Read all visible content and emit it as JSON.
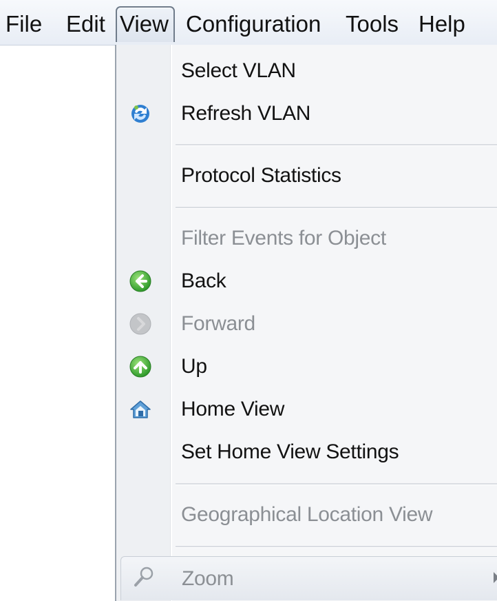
{
  "menubar": {
    "items": [
      {
        "label": "File"
      },
      {
        "label": "Edit"
      },
      {
        "label": "View"
      },
      {
        "label": "Configuration"
      },
      {
        "label": "Tools"
      },
      {
        "label": "Help"
      }
    ],
    "active": "View"
  },
  "view_menu": {
    "items": [
      {
        "label": "Select VLAN",
        "icon": null,
        "enabled": true
      },
      {
        "label": "Refresh VLAN",
        "icon": "refresh-icon",
        "enabled": true
      },
      {
        "label": "Protocol Statistics",
        "icon": null,
        "enabled": true
      },
      {
        "label": "Filter Events for Object",
        "icon": null,
        "enabled": false
      },
      {
        "label": "Back",
        "icon": "back-arrow-icon",
        "enabled": true
      },
      {
        "label": "Forward",
        "icon": "forward-arrow-icon",
        "enabled": false
      },
      {
        "label": "Up",
        "icon": "up-arrow-icon",
        "enabled": true
      },
      {
        "label": "Home View",
        "icon": "home-icon",
        "enabled": true
      },
      {
        "label": "Set Home View Settings",
        "icon": null,
        "enabled": true
      },
      {
        "label": "Geographical Location View",
        "icon": null,
        "enabled": false
      },
      {
        "label": "Zoom",
        "icon": "magnifier-icon",
        "enabled": false,
        "has_submenu": true
      }
    ]
  },
  "colors": {
    "enabled_text": "#121212",
    "disabled_text": "#8b8f94",
    "menu_background": "#f5f6f8",
    "back_icon": "#3fae3a",
    "up_icon": "#3fae3a",
    "refresh_icon": "#2f7fd1"
  }
}
